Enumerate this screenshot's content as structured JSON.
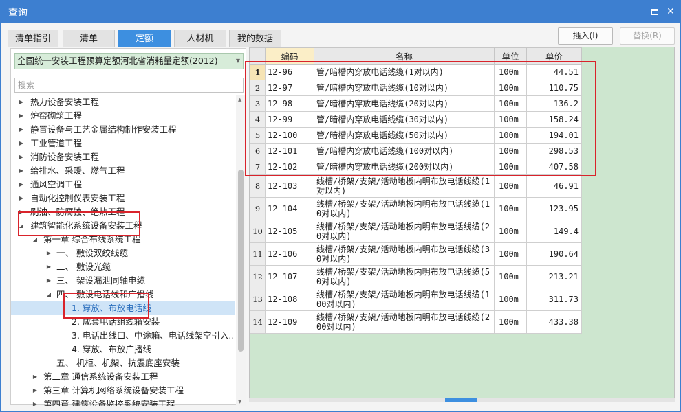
{
  "window": {
    "title": "查询",
    "restore_label": "restore",
    "close_label": "✕"
  },
  "tabs": [
    {
      "label": "清单指引",
      "active": false
    },
    {
      "label": "清单",
      "active": false
    },
    {
      "label": "定额",
      "active": true
    },
    {
      "label": "人材机",
      "active": false
    },
    {
      "label": "我的数据",
      "active": false
    }
  ],
  "actions": {
    "insert_label": "插入(I)",
    "replace_label": "替换(R)"
  },
  "left": {
    "library_selected": "全国统一安装工程预算定额河北省消耗量定额(2012)",
    "search_placeholder": "搜索",
    "tree": [
      {
        "label": "热力设备安装工程",
        "toggle": "▶",
        "level": 0
      },
      {
        "label": "炉窑砌筑工程",
        "toggle": "▶",
        "level": 0
      },
      {
        "label": "静置设备与工艺金属结构制作安装工程",
        "toggle": "▶",
        "level": 0
      },
      {
        "label": "工业管道工程",
        "toggle": "▶",
        "level": 0
      },
      {
        "label": "消防设备安装工程",
        "toggle": "▶",
        "level": 0
      },
      {
        "label": "给排水、采暖、燃气工程",
        "toggle": "▶",
        "level": 0
      },
      {
        "label": "通风空调工程",
        "toggle": "▶",
        "level": 0
      },
      {
        "label": "自动化控制仪表安装工程",
        "toggle": "▶",
        "level": 0
      },
      {
        "label": "刷油、防腐蚀、绝热工程",
        "toggle": "▶",
        "level": 0
      },
      {
        "label": "建筑智能化系统设备安装工程",
        "toggle": "◢",
        "level": 0
      },
      {
        "label": "第一章 综合布线系统工程",
        "toggle": "◢",
        "level": 1
      },
      {
        "label": "一、 敷设双绞线缆",
        "toggle": "▶",
        "level": 2
      },
      {
        "label": "二、 敷设光缆",
        "toggle": "▶",
        "level": 2
      },
      {
        "label": "三、 架设漏泄同轴电缆",
        "toggle": "▶",
        "level": 2
      },
      {
        "label": "四、 敷设电话线和广播线",
        "toggle": "◢",
        "level": 2
      },
      {
        "label": "1. 穿放、布放电话线",
        "toggle": "",
        "level": 3,
        "selected": true
      },
      {
        "label": "2. 成套电话组线箱安装",
        "toggle": "",
        "level": 3
      },
      {
        "label": "3. 电话出线口、中途箱、电话线架空引入...",
        "toggle": "",
        "level": 3
      },
      {
        "label": "4. 穿放、布放广播线",
        "toggle": "",
        "level": 3
      },
      {
        "label": "五、 机柜、机架、抗震底座安装",
        "toggle": "",
        "level": 2
      },
      {
        "label": "第二章 通信系统设备安装工程",
        "toggle": "▶",
        "level": 1
      },
      {
        "label": "第三章 计算机网络系统设备安装工程",
        "toggle": "▶",
        "level": 1
      },
      {
        "label": "第四章 建筑设备监控系统安装工程",
        "toggle": "▶",
        "level": 1
      }
    ]
  },
  "grid": {
    "headers": [
      "编码",
      "名称",
      "单位",
      "单价"
    ],
    "rows": [
      {
        "no": "1",
        "code": "12-96",
        "name": "管/暗槽内穿放电话线缆(1对以内)",
        "unit": "100m",
        "price": "44.51"
      },
      {
        "no": "2",
        "code": "12-97",
        "name": "管/暗槽内穿放电话线缆(10对以内)",
        "unit": "100m",
        "price": "110.75"
      },
      {
        "no": "3",
        "code": "12-98",
        "name": "管/暗槽内穿放电话线缆(20对以内)",
        "unit": "100m",
        "price": "136.2"
      },
      {
        "no": "4",
        "code": "12-99",
        "name": "管/暗槽内穿放电话线缆(30对以内)",
        "unit": "100m",
        "price": "158.24"
      },
      {
        "no": "5",
        "code": "12-100",
        "name": "管/暗槽内穿放电话线缆(50对以内)",
        "unit": "100m",
        "price": "194.01"
      },
      {
        "no": "6",
        "code": "12-101",
        "name": "管/暗槽内穿放电话线缆(100对以内)",
        "unit": "100m",
        "price": "298.53"
      },
      {
        "no": "7",
        "code": "12-102",
        "name": "管/暗槽内穿放电话线缆(200对以内)",
        "unit": "100m",
        "price": "407.58"
      },
      {
        "no": "8",
        "code": "12-103",
        "name": "线槽/桥架/支架/活动地板内明布放电话线缆(1对以内)",
        "unit": "100m",
        "price": "46.91"
      },
      {
        "no": "9",
        "code": "12-104",
        "name": "线槽/桥架/支架/活动地板内明布放电话线缆(10对以内)",
        "unit": "100m",
        "price": "123.95"
      },
      {
        "no": "10",
        "code": "12-105",
        "name": "线槽/桥架/支架/活动地板内明布放电话线缆(20对以内)",
        "unit": "100m",
        "price": "149.4"
      },
      {
        "no": "11",
        "code": "12-106",
        "name": "线槽/桥架/支架/活动地板内明布放电话线缆(30对以内)",
        "unit": "100m",
        "price": "190.64"
      },
      {
        "no": "12",
        "code": "12-107",
        "name": "线槽/桥架/支架/活动地板内明布放电话线缆(50对以内)",
        "unit": "100m",
        "price": "213.21"
      },
      {
        "no": "13",
        "code": "12-108",
        "name": "线槽/桥架/支架/活动地板内明布放电话线缆(100对以内)",
        "unit": "100m",
        "price": "311.73"
      },
      {
        "no": "14",
        "code": "12-109",
        "name": "线槽/桥架/支架/活动地板内明布放电话线缆(200对以内)",
        "unit": "100m",
        "price": "433.38"
      }
    ]
  },
  "colors": {
    "titlebar": "#3d7fd0",
    "active_tab": "#3d8fe0",
    "highlight": "#d9232b",
    "grid_background": "#cde6cf"
  }
}
